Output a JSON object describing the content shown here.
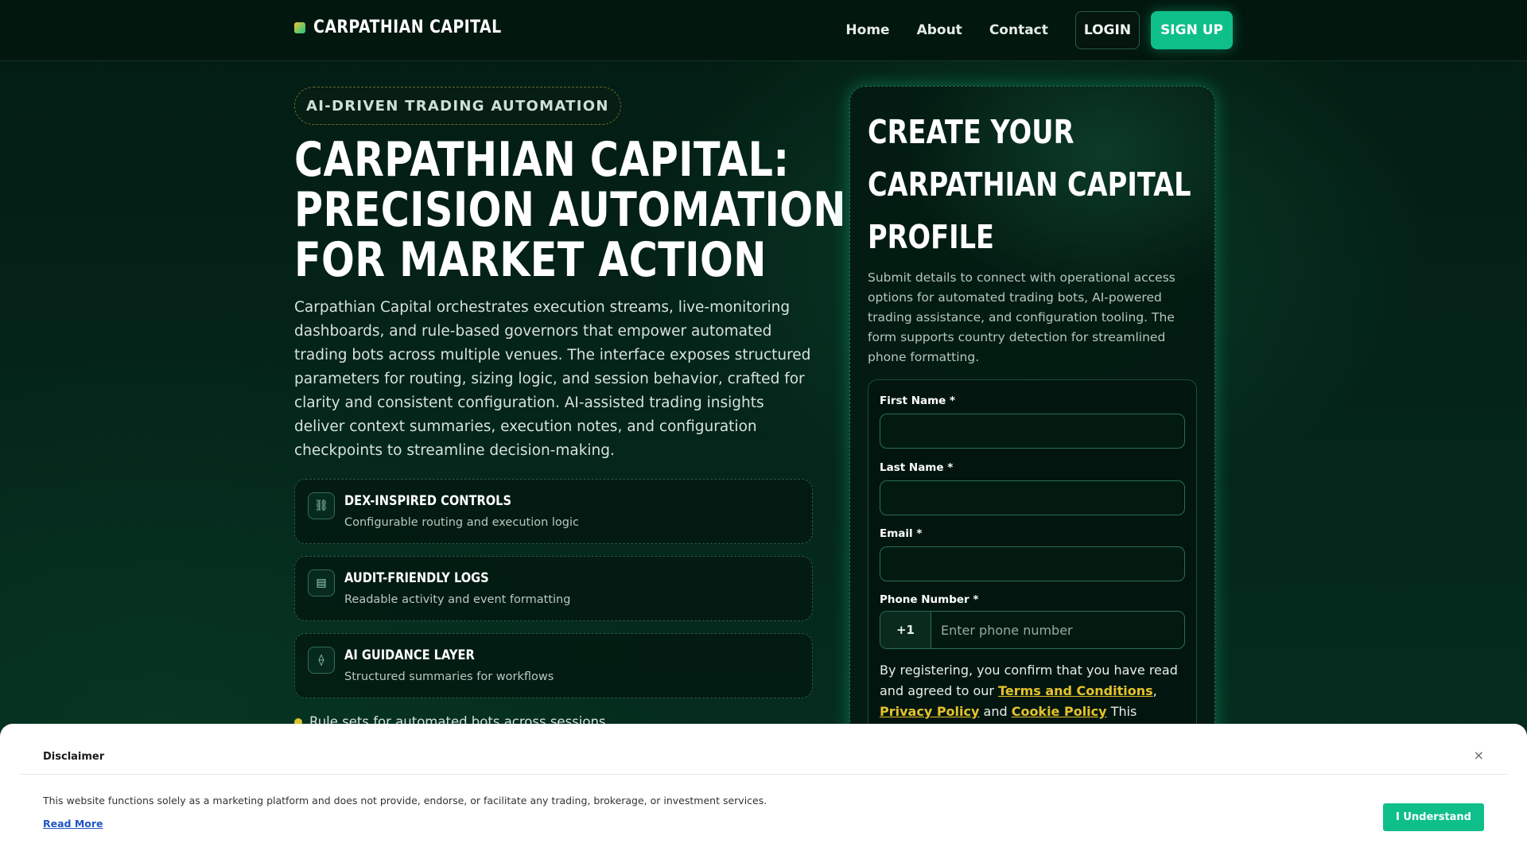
{
  "header": {
    "brand": "CARPATHIAN CAPITAL",
    "nav": [
      "Home",
      "About",
      "Contact"
    ],
    "login": "LOGIN",
    "signup": "SIGN UP"
  },
  "hero": {
    "pill": "AI-DRIVEN TRADING AUTOMATION",
    "title_lines": [
      "CARPATHIAN CAPITAL:",
      "PRECISION AUTOMATION",
      "FOR MARKET ACTION"
    ],
    "body": "Carpathian Capital orchestrates execution streams, live-monitoring dashboards, and rule-based governors that empower automated trading bots across multiple venues. The interface exposes structured parameters for routing, sizing logic, and session behavior, crafted for clarity and consistent configuration. AI-assisted trading insights deliver context summaries, execution notes, and configuration checkpoints to streamline decision-making.",
    "features": [
      {
        "icon": "link-icon",
        "glyph": "⛓",
        "title": "DEX-INSPIRED CONTROLS",
        "sub": "Configurable routing and execution logic"
      },
      {
        "icon": "list-icon",
        "glyph": "▤",
        "title": "AUDIT-FRIENDLY LOGS",
        "sub": "Readable activity and event formatting"
      },
      {
        "icon": "diamond-icon",
        "glyph": "⟠",
        "title": "AI GUIDANCE LAYER",
        "sub": "Structured summaries for workflows"
      }
    ],
    "bullet": "Rule sets for automated bots across sessions"
  },
  "form_card": {
    "title_lines": [
      "CREATE YOUR",
      "CARPATHIAN CAPITAL",
      "PROFILE"
    ],
    "description": "Submit details to connect with operational access options for automated trading bots, AI-powered trading assistance, and configuration tooling. The form supports country detection for streamlined phone formatting.",
    "first_name_label": "First Name *",
    "first_name_value": "",
    "last_name_label": "Last Name *",
    "last_name_value": "",
    "email_label": "Email *",
    "email_value": "",
    "phone_label": "Phone Number *",
    "phone_code": "+1",
    "phone_placeholder": "Enter phone number",
    "consent_prefix": "By registering, you confirm that you have read and agreed to our ",
    "terms_link": "Terms and Conditions",
    "comma": ",",
    "privacy_link": "Privacy Policy",
    "and_text": " and ",
    "cookie_link": "Cookie Policy",
    "consent_suffix": " This"
  },
  "disclaimer": {
    "title": "Disclaimer",
    "close": "×",
    "text": "This website functions solely as a marketing platform and does not provide, endorse, or facilitate any trading, brokerage, or investment services.",
    "read_more": "Read More",
    "button": "I Understand"
  },
  "colors": {
    "accent": "#0fbf8a",
    "gold": "#e6c22c",
    "background": "#04241a"
  }
}
